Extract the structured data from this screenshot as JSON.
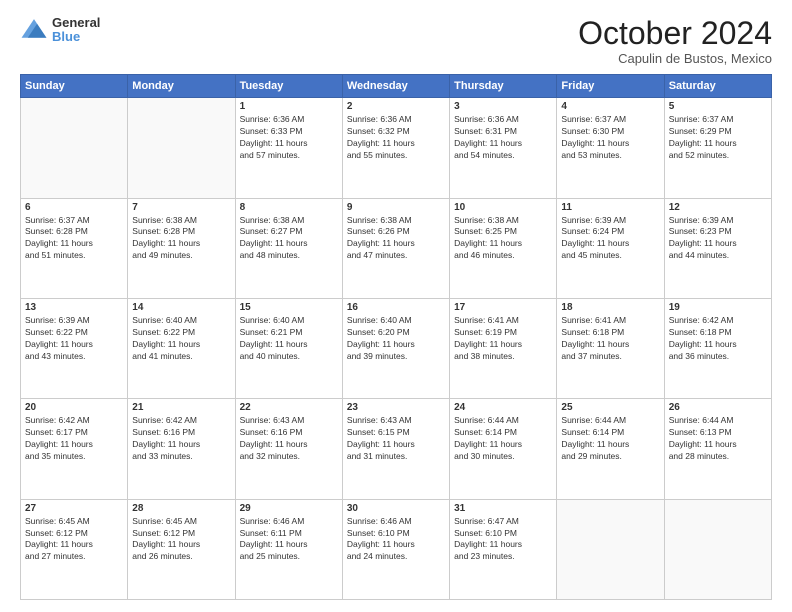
{
  "header": {
    "logo_line1": "General",
    "logo_line2": "Blue",
    "month": "October 2024",
    "location": "Capulin de Bustos, Mexico"
  },
  "days_of_week": [
    "Sunday",
    "Monday",
    "Tuesday",
    "Wednesday",
    "Thursday",
    "Friday",
    "Saturday"
  ],
  "weeks": [
    [
      {
        "day": "",
        "lines": []
      },
      {
        "day": "",
        "lines": []
      },
      {
        "day": "1",
        "lines": [
          "Sunrise: 6:36 AM",
          "Sunset: 6:33 PM",
          "Daylight: 11 hours",
          "and 57 minutes."
        ]
      },
      {
        "day": "2",
        "lines": [
          "Sunrise: 6:36 AM",
          "Sunset: 6:32 PM",
          "Daylight: 11 hours",
          "and 55 minutes."
        ]
      },
      {
        "day": "3",
        "lines": [
          "Sunrise: 6:36 AM",
          "Sunset: 6:31 PM",
          "Daylight: 11 hours",
          "and 54 minutes."
        ]
      },
      {
        "day": "4",
        "lines": [
          "Sunrise: 6:37 AM",
          "Sunset: 6:30 PM",
          "Daylight: 11 hours",
          "and 53 minutes."
        ]
      },
      {
        "day": "5",
        "lines": [
          "Sunrise: 6:37 AM",
          "Sunset: 6:29 PM",
          "Daylight: 11 hours",
          "and 52 minutes."
        ]
      }
    ],
    [
      {
        "day": "6",
        "lines": [
          "Sunrise: 6:37 AM",
          "Sunset: 6:28 PM",
          "Daylight: 11 hours",
          "and 51 minutes."
        ]
      },
      {
        "day": "7",
        "lines": [
          "Sunrise: 6:38 AM",
          "Sunset: 6:28 PM",
          "Daylight: 11 hours",
          "and 49 minutes."
        ]
      },
      {
        "day": "8",
        "lines": [
          "Sunrise: 6:38 AM",
          "Sunset: 6:27 PM",
          "Daylight: 11 hours",
          "and 48 minutes."
        ]
      },
      {
        "day": "9",
        "lines": [
          "Sunrise: 6:38 AM",
          "Sunset: 6:26 PM",
          "Daylight: 11 hours",
          "and 47 minutes."
        ]
      },
      {
        "day": "10",
        "lines": [
          "Sunrise: 6:38 AM",
          "Sunset: 6:25 PM",
          "Daylight: 11 hours",
          "and 46 minutes."
        ]
      },
      {
        "day": "11",
        "lines": [
          "Sunrise: 6:39 AM",
          "Sunset: 6:24 PM",
          "Daylight: 11 hours",
          "and 45 minutes."
        ]
      },
      {
        "day": "12",
        "lines": [
          "Sunrise: 6:39 AM",
          "Sunset: 6:23 PM",
          "Daylight: 11 hours",
          "and 44 minutes."
        ]
      }
    ],
    [
      {
        "day": "13",
        "lines": [
          "Sunrise: 6:39 AM",
          "Sunset: 6:22 PM",
          "Daylight: 11 hours",
          "and 43 minutes."
        ]
      },
      {
        "day": "14",
        "lines": [
          "Sunrise: 6:40 AM",
          "Sunset: 6:22 PM",
          "Daylight: 11 hours",
          "and 41 minutes."
        ]
      },
      {
        "day": "15",
        "lines": [
          "Sunrise: 6:40 AM",
          "Sunset: 6:21 PM",
          "Daylight: 11 hours",
          "and 40 minutes."
        ]
      },
      {
        "day": "16",
        "lines": [
          "Sunrise: 6:40 AM",
          "Sunset: 6:20 PM",
          "Daylight: 11 hours",
          "and 39 minutes."
        ]
      },
      {
        "day": "17",
        "lines": [
          "Sunrise: 6:41 AM",
          "Sunset: 6:19 PM",
          "Daylight: 11 hours",
          "and 38 minutes."
        ]
      },
      {
        "day": "18",
        "lines": [
          "Sunrise: 6:41 AM",
          "Sunset: 6:18 PM",
          "Daylight: 11 hours",
          "and 37 minutes."
        ]
      },
      {
        "day": "19",
        "lines": [
          "Sunrise: 6:42 AM",
          "Sunset: 6:18 PM",
          "Daylight: 11 hours",
          "and 36 minutes."
        ]
      }
    ],
    [
      {
        "day": "20",
        "lines": [
          "Sunrise: 6:42 AM",
          "Sunset: 6:17 PM",
          "Daylight: 11 hours",
          "and 35 minutes."
        ]
      },
      {
        "day": "21",
        "lines": [
          "Sunrise: 6:42 AM",
          "Sunset: 6:16 PM",
          "Daylight: 11 hours",
          "and 33 minutes."
        ]
      },
      {
        "day": "22",
        "lines": [
          "Sunrise: 6:43 AM",
          "Sunset: 6:16 PM",
          "Daylight: 11 hours",
          "and 32 minutes."
        ]
      },
      {
        "day": "23",
        "lines": [
          "Sunrise: 6:43 AM",
          "Sunset: 6:15 PM",
          "Daylight: 11 hours",
          "and 31 minutes."
        ]
      },
      {
        "day": "24",
        "lines": [
          "Sunrise: 6:44 AM",
          "Sunset: 6:14 PM",
          "Daylight: 11 hours",
          "and 30 minutes."
        ]
      },
      {
        "day": "25",
        "lines": [
          "Sunrise: 6:44 AM",
          "Sunset: 6:14 PM",
          "Daylight: 11 hours",
          "and 29 minutes."
        ]
      },
      {
        "day": "26",
        "lines": [
          "Sunrise: 6:44 AM",
          "Sunset: 6:13 PM",
          "Daylight: 11 hours",
          "and 28 minutes."
        ]
      }
    ],
    [
      {
        "day": "27",
        "lines": [
          "Sunrise: 6:45 AM",
          "Sunset: 6:12 PM",
          "Daylight: 11 hours",
          "and 27 minutes."
        ]
      },
      {
        "day": "28",
        "lines": [
          "Sunrise: 6:45 AM",
          "Sunset: 6:12 PM",
          "Daylight: 11 hours",
          "and 26 minutes."
        ]
      },
      {
        "day": "29",
        "lines": [
          "Sunrise: 6:46 AM",
          "Sunset: 6:11 PM",
          "Daylight: 11 hours",
          "and 25 minutes."
        ]
      },
      {
        "day": "30",
        "lines": [
          "Sunrise: 6:46 AM",
          "Sunset: 6:10 PM",
          "Daylight: 11 hours",
          "and 24 minutes."
        ]
      },
      {
        "day": "31",
        "lines": [
          "Sunrise: 6:47 AM",
          "Sunset: 6:10 PM",
          "Daylight: 11 hours",
          "and 23 minutes."
        ]
      },
      {
        "day": "",
        "lines": []
      },
      {
        "day": "",
        "lines": []
      }
    ]
  ]
}
